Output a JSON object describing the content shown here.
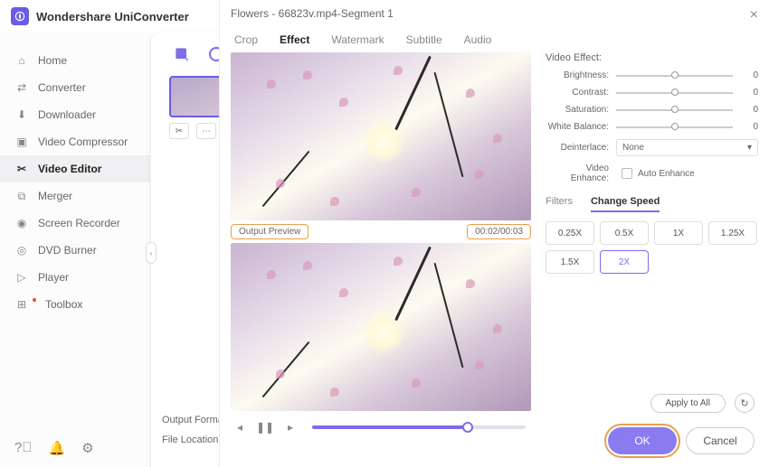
{
  "app_title": "Wondershare UniConverter",
  "sidebar": {
    "items": [
      {
        "label": "Home"
      },
      {
        "label": "Converter"
      },
      {
        "label": "Downloader"
      },
      {
        "label": "Video Compressor"
      },
      {
        "label": "Video Editor"
      },
      {
        "label": "Merger"
      },
      {
        "label": "Screen Recorder"
      },
      {
        "label": "DVD Burner"
      },
      {
        "label": "Player"
      },
      {
        "label": "Toolbox"
      }
    ]
  },
  "bottom_labels": {
    "output_format": "Output Format:",
    "file_location": "File Location:"
  },
  "editor": {
    "title": "Flowers - 66823v.mp4-Segment 1",
    "tabs": [
      "Crop",
      "Effect",
      "Watermark",
      "Subtitle",
      "Audio"
    ],
    "active_tab": "Effect",
    "preview_label": "Output Preview",
    "time_display": "00:02/00:03"
  },
  "effect_panel": {
    "title": "Video Effect:",
    "sliders": [
      {
        "label": "Brightness:",
        "value": "0"
      },
      {
        "label": "Contrast:",
        "value": "0"
      },
      {
        "label": "Saturation:",
        "value": "0"
      },
      {
        "label": "White Balance:",
        "value": "0"
      }
    ],
    "deinterlace_label": "Deinterlace:",
    "deinterlace_value": "None",
    "enhance_label": "Video Enhance:",
    "enhance_checkbox": "Auto Enhance"
  },
  "subtabs": {
    "items": [
      "Filters",
      "Change Speed"
    ],
    "active": "Change Speed"
  },
  "speeds": [
    "0.25X",
    "0.5X",
    "1X",
    "1.25X",
    "1.5X",
    "2X"
  ],
  "active_speed": "2X",
  "apply_all": "Apply to All",
  "ok": "OK",
  "cancel": "Cancel"
}
